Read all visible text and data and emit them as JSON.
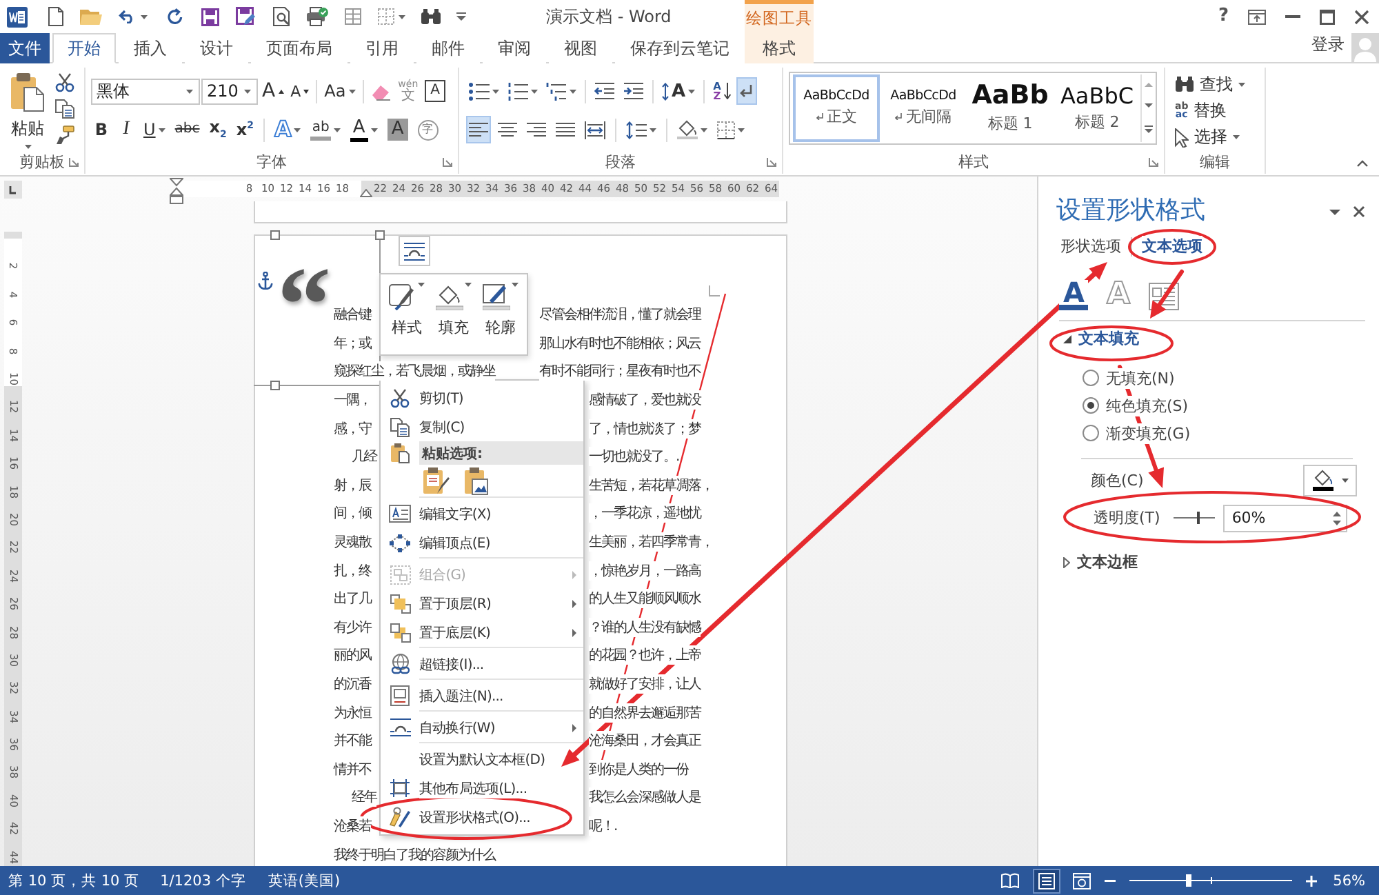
{
  "title_bar": {
    "title": "演示文档 - Word",
    "help": "?"
  },
  "context_tab_group": {
    "title": "绘图工具"
  },
  "tabs": [
    {
      "label": "文件",
      "kind": "file",
      "selected": false
    },
    {
      "label": "开始",
      "kind": "normal",
      "selected": true
    },
    {
      "label": "插入",
      "kind": "normal",
      "selected": false
    },
    {
      "label": "设计",
      "kind": "normal",
      "selected": false
    },
    {
      "label": "页面布局",
      "kind": "normal",
      "selected": false
    },
    {
      "label": "引用",
      "kind": "normal",
      "selected": false
    },
    {
      "label": "邮件",
      "kind": "normal",
      "selected": false
    },
    {
      "label": "审阅",
      "kind": "normal",
      "selected": false
    },
    {
      "label": "视图",
      "kind": "normal",
      "selected": false
    },
    {
      "label": "保存到云笔记",
      "kind": "normal",
      "selected": false
    },
    {
      "label": "格式",
      "kind": "contextual",
      "selected": false
    }
  ],
  "account": {
    "label": "登录"
  },
  "ribbon": {
    "clipboard": {
      "title": "剪贴板",
      "paste_label": "粘贴"
    },
    "font": {
      "title": "字体",
      "font_name": "黑体",
      "font_size": "210",
      "row1": [
        {
          "kind": "grow",
          "label": "A"
        },
        {
          "kind": "shrink",
          "label": "A"
        },
        {
          "kind": "case",
          "label": "Aa",
          "dropdown": true
        },
        {
          "kind": "clear"
        },
        {
          "kind": "pinyin",
          "label": "文",
          "ruby": "wén"
        },
        {
          "kind": "border",
          "label": "A"
        }
      ],
      "row2": [
        {
          "kind": "bold",
          "label": "B"
        },
        {
          "kind": "italic",
          "label": "I"
        },
        {
          "kind": "underline",
          "label": "U",
          "dropdown": true
        },
        {
          "kind": "strike",
          "label": "abc"
        },
        {
          "kind": "subscript",
          "label": "x$_{2}$"
        },
        {
          "kind": "superscript",
          "label": "x$^{2}$"
        },
        {
          "kind": "effects",
          "label": "A",
          "dropdown": true
        },
        {
          "kind": "highlight",
          "label": "ab",
          "dropdown": true
        },
        {
          "kind": "color",
          "label": "A",
          "dropdown": true
        },
        {
          "kind": "shading",
          "label": "A"
        },
        {
          "kind": "enclose",
          "label": "字"
        }
      ]
    },
    "paragraph": {
      "title": "段落",
      "row1": [
        {
          "kind": "bullets",
          "dropdown": true,
          "selected": false
        },
        {
          "kind": "numbering",
          "dropdown": true,
          "selected": false
        },
        {
          "kind": "multilevel",
          "dropdown": true,
          "selected": false
        },
        {
          "kind": "decrease_indent",
          "selected": false
        },
        {
          "kind": "increase_indent",
          "selected": false
        },
        {
          "kind": "asian_layout",
          "label": "A",
          "dropdown": true,
          "selected": false
        },
        {
          "kind": "sort",
          "label": "A",
          "label2": "Z",
          "selected": false
        },
        {
          "kind": "show_marks",
          "selected": true
        }
      ],
      "row2": [
        {
          "kind": "align_left",
          "selected": true
        },
        {
          "kind": "align_center",
          "selected": false
        },
        {
          "kind": "align_right",
          "selected": false
        },
        {
          "kind": "justify",
          "selected": false
        },
        {
          "kind": "distributed",
          "selected": false
        },
        {
          "kind": "line_spacing",
          "dropdown": true,
          "selected": false
        },
        {
          "kind": "shading",
          "dropdown": true,
          "selected": false
        },
        {
          "kind": "borders",
          "dropdown": true,
          "selected": false
        }
      ]
    },
    "styles": {
      "title": "样式",
      "items": [
        {
          "kind": "body",
          "sample": "AaBbCcDd",
          "name": "正文",
          "selected": true
        },
        {
          "kind": "body",
          "sample": "AaBbCcDd",
          "name": "无间隔",
          "selected": false
        },
        {
          "kind": "heading1",
          "sample": "AaBb",
          "name": "标题 1",
          "selected": false
        },
        {
          "kind": "heading2",
          "sample": "AaBbC",
          "name": "标题 2",
          "selected": false
        }
      ]
    },
    "editing": {
      "title": "编辑",
      "items": [
        {
          "kind": "find",
          "label": "查找",
          "dropdown": true
        },
        {
          "kind": "replace",
          "label": "替换",
          "icon_text": [
            "ab",
            "ac"
          ]
        },
        {
          "kind": "select",
          "label": "选择",
          "dropdown": true
        }
      ]
    }
  },
  "ruler": {
    "numbers": [
      "8",
      "10",
      "12",
      "14",
      "16",
      "18"
    ],
    "shaded_numbers": [
      "22",
      "24",
      "26",
      "28",
      "30",
      "32",
      "34",
      "36",
      "38",
      "40",
      "42",
      "44",
      "46",
      "48",
      "50",
      "52",
      "54",
      "56",
      "58",
      "60",
      "62",
      "64"
    ]
  },
  "vertical_ruler": {
    "numbers": [
      "2",
      "4",
      "6",
      "8",
      "10",
      "12",
      "14",
      "16",
      "18",
      "20",
      "22",
      "24",
      "26",
      "28",
      "30",
      "32",
      "34",
      "36",
      "38",
      "40",
      "42",
      "44"
    ]
  },
  "document": {
    "quote_mark": "“",
    "lines": [
      {
        "kind": "line",
        "left": "融合键",
        "right": "尽管会相伴流泪，懂了就会理"
      },
      {
        "kind": "line",
        "left": "年；或",
        "right": "那山水有时也不能相依；风云"
      },
      {
        "kind": "line",
        "left": "窥探红尘，若飞晨烟，或静坐",
        "right": "有时不能同行；星夜有时也不"
      },
      {
        "kind": "line",
        "left": "一隅，",
        "right": "感情破了，爱也就没"
      },
      {
        "kind": "line",
        "left": "感，守",
        "right": "了，情也就淡了；梦"
      },
      {
        "kind": "paragraph_start",
        "left": "几经",
        "right": "一切也就没了。."
      },
      {
        "kind": "line",
        "left": "射，辰",
        "right": "生苦短，若花草凋落，"
      },
      {
        "kind": "line",
        "left": "间，倾",
        "right": "，一季花凉，遥地忧"
      },
      {
        "kind": "line",
        "left": "灵魂散",
        "right": "生美丽，若四季常青，"
      },
      {
        "kind": "line",
        "left": "扎，终",
        "right": "，惊艳岁月，一路高"
      },
      {
        "kind": "line",
        "left": "出了几",
        "right": "的人生又能顺风顺水"
      },
      {
        "kind": "line",
        "left": "有少许",
        "right": "？谁的人生没有缺憾"
      },
      {
        "kind": "line",
        "left": "丽的风",
        "right": "的花园？也许，上帝"
      },
      {
        "kind": "line",
        "left": "的沉香",
        "right": "就做好了安排，让人"
      },
      {
        "kind": "line",
        "left": "为永恒",
        "right": "的自然界去邂逅那苦"
      },
      {
        "kind": "line",
        "left": "并不能",
        "right": "沧海桑田，才会真正"
      },
      {
        "kind": "line",
        "left": "情并不",
        "right": "到你是人类的一份"
      },
      {
        "kind": "paragraph_start",
        "left": "经年",
        "right": "我怎么会深感做人是"
      },
      {
        "kind": "line",
        "left": "沧桑若",
        "right": "呢！."
      },
      {
        "kind": "line",
        "left": "我终于明白了我的容颜为什么"
      }
    ]
  },
  "mini_toolbar": {
    "buttons": [
      {
        "label": "样式"
      },
      {
        "label": "填充"
      },
      {
        "label": "轮廓"
      }
    ]
  },
  "context_menu": {
    "groups": [
      [
        {
          "kind": "item",
          "label": "剪切(T)",
          "disabled": false
        },
        {
          "kind": "item",
          "label": "复制(C)",
          "disabled": false
        },
        {
          "kind": "header",
          "label": "粘贴选项:"
        },
        {
          "kind": "paste_options"
        }
      ],
      [
        {
          "kind": "item",
          "label": "编辑文字(X)",
          "disabled": false
        },
        {
          "kind": "item",
          "label": "编辑顶点(E)",
          "disabled": false
        }
      ],
      [
        {
          "kind": "item",
          "label": "组合(G)",
          "disabled": true,
          "submenu": true
        },
        {
          "kind": "item",
          "label": "置于顶层(R)",
          "disabled": false,
          "submenu": true
        },
        {
          "kind": "item",
          "label": "置于底层(K)",
          "disabled": false,
          "submenu": true
        }
      ],
      [
        {
          "kind": "item",
          "label": "超链接(I)...",
          "disabled": false
        }
      ],
      [
        {
          "kind": "item",
          "label": "插入题注(N)...",
          "disabled": false
        }
      ],
      [
        {
          "kind": "item",
          "label": "自动换行(W)",
          "disabled": false,
          "submenu": true
        }
      ],
      [
        {
          "kind": "item",
          "label": "设置为默认文本框(D)",
          "disabled": false
        },
        {
          "kind": "item",
          "label": "其他布局选项(L)...",
          "disabled": false
        },
        {
          "kind": "item",
          "label": "设置形状格式(O)...",
          "disabled": false
        }
      ]
    ]
  },
  "format_pane": {
    "title": "设置形状格式",
    "tabs": [
      {
        "label": "形状选项",
        "selected": false
      },
      {
        "label": "文本选项",
        "selected": true
      }
    ],
    "icon_tabs": [
      {
        "kind": "fill_outline",
        "label": "A",
        "selected": true
      },
      {
        "kind": "effects",
        "label": "A",
        "selected": false
      },
      {
        "kind": "layout",
        "selected": false
      }
    ],
    "text_fill": {
      "title": "文本填充",
      "expanded": true,
      "options": [
        {
          "label": "无填充(N)",
          "selected": false
        },
        {
          "label": "纯色填充(S)",
          "selected": true
        },
        {
          "label": "渐变填充(G)",
          "selected": false
        }
      ],
      "color_label": "颜色(C)",
      "transparency": {
        "label": "透明度(T)",
        "level": 0.6,
        "value": "60%"
      }
    },
    "text_outline": {
      "title": "文本边框",
      "expanded": false
    }
  },
  "status_bar": {
    "page": "第 10 页，共 10 页",
    "words": "1/1203 个字",
    "language": "英语(美国)",
    "views": [
      {
        "kind": "read",
        "selected": false
      },
      {
        "kind": "print",
        "selected": true
      },
      {
        "kind": "web",
        "selected": false
      }
    ],
    "zoom": {
      "level": 0.37,
      "value": "56%"
    }
  }
}
